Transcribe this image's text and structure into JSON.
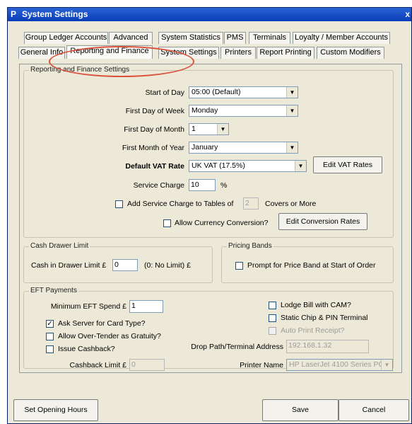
{
  "window": {
    "title": "System Settings",
    "close_glyph": "x"
  },
  "tabs_row1": [
    {
      "label": "Group Ledger Accounts"
    },
    {
      "label": "Advanced"
    },
    {
      "label": "System Statistics"
    },
    {
      "label": "PMS"
    },
    {
      "label": "Terminals"
    },
    {
      "label": "Loyalty / Member Accounts"
    }
  ],
  "tabs_row2": [
    {
      "label": "General Info"
    },
    {
      "label": "Reporting and Finance"
    },
    {
      "label": "System Settings"
    },
    {
      "label": "Printers"
    },
    {
      "label": "Report Printing"
    },
    {
      "label": "Custom Modifiers"
    }
  ],
  "reporting": {
    "legend": "Reporting and Finance Settings",
    "start_of_day_label": "Start of Day",
    "start_of_day_value": "05:00 (Default)",
    "first_day_week_label": "First Day of Week",
    "first_day_week_value": "Monday",
    "first_day_month_label": "First Day of Month",
    "first_day_month_value": "1",
    "first_month_year_label": "First Month of Year",
    "first_month_year_value": "January",
    "default_vat_label": "Default VAT Rate",
    "default_vat_value": "UK VAT (17.5%)",
    "edit_vat_button": "Edit VAT Rates",
    "service_charge_label": "Service Charge",
    "service_charge_value": "10",
    "service_charge_unit": "%",
    "add_service_charge_label": "Add Service Charge to Tables of",
    "covers_value": "2",
    "covers_suffix": "Covers or More",
    "allow_currency_label": "Allow Currency Conversion?",
    "edit_conversion_button": "Edit Conversion Rates"
  },
  "cash_drawer": {
    "legend": "Cash Drawer Limit",
    "label": "Cash in Drawer Limit £",
    "value": "0",
    "hint": "(0: No Limit) £"
  },
  "pricing_bands": {
    "legend": "Pricing Bands",
    "prompt_label": "Prompt for Price Band at Start of Order"
  },
  "eft": {
    "legend": "EFT Payments",
    "min_spend_label": "Minimum EFT Spend £",
    "min_spend_value": "1",
    "ask_server_label": "Ask Server for Card Type?",
    "ask_server_checked": true,
    "allow_over_tender_label": "Allow Over-Tender as Gratuity?",
    "issue_cashback_label": "Issue Cashback?",
    "cashback_limit_label": "Cashback Limit £",
    "cashback_limit_value": "0",
    "lodge_bill_label": "Lodge Bill with CAM?",
    "static_chip_label": "Static Chip & PIN Terminal",
    "auto_print_label": "Auto Print Receipt?",
    "drop_path_label": "Drop Path/Terminal Address",
    "drop_path_value": "192.168.1.32",
    "printer_name_label": "Printer Name",
    "printer_name_value": "HP LaserJet 4100 Series PC"
  },
  "footer": {
    "set_opening_hours": "Set Opening Hours",
    "save": "Save",
    "cancel": "Cancel"
  },
  "checkmark_glyph": "✓",
  "dropdown_arrow_glyph": "▼",
  "app_icon_glyph": "P",
  "accent_colors": {
    "titlebar": "#0a3cb8",
    "highlight_ellipse": "#d9533b"
  }
}
